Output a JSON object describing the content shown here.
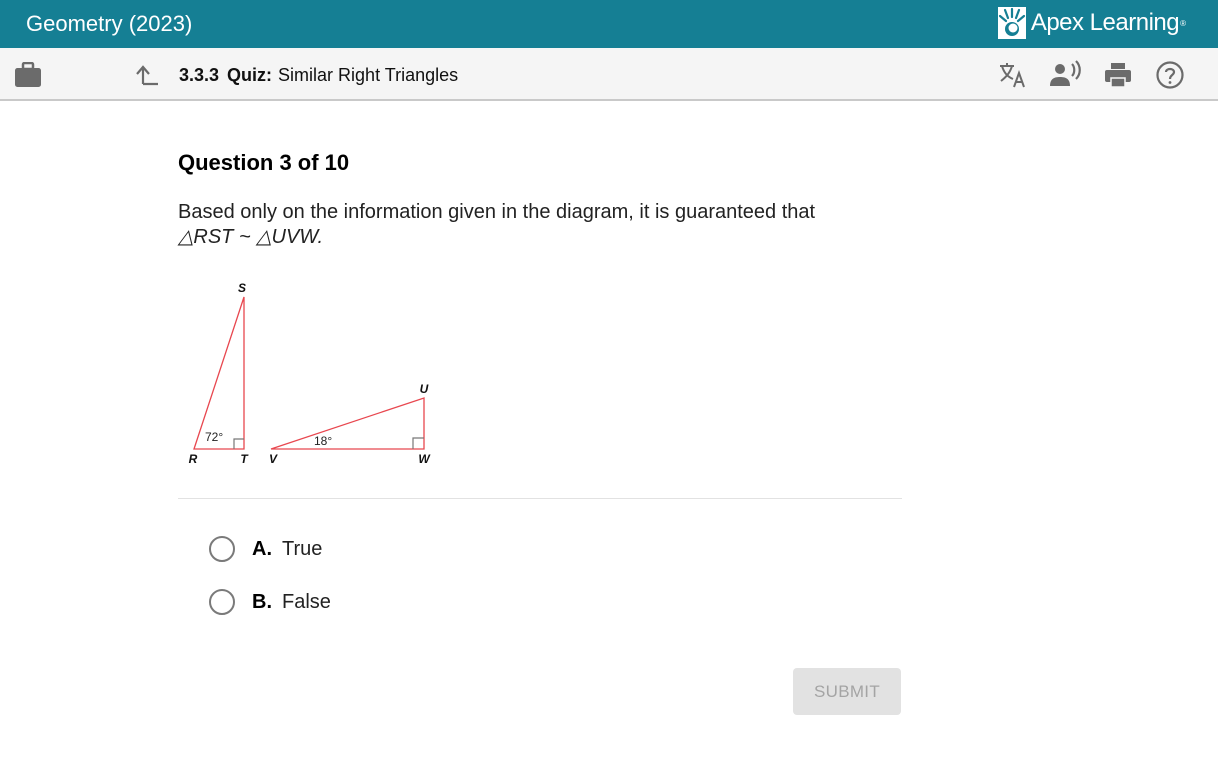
{
  "header": {
    "course_title": "Geometry (2023)",
    "brand": "Apex Learning",
    "brand_mark": "®",
    "accent_color": "#157f94"
  },
  "subheader": {
    "lesson_number": "3.3.3",
    "lesson_type": "Quiz:",
    "lesson_title": "Similar Right Triangles",
    "icons": [
      "briefcase-icon",
      "up-arrow-icon",
      "translate-icon",
      "read-aloud-icon",
      "print-icon",
      "help-icon"
    ]
  },
  "question": {
    "heading": "Question 3 of 10",
    "prompt": "Based only on the information given in the diagram, it is guaranteed that",
    "statement": "△RST ~ △UVW."
  },
  "diagram": {
    "triangle1": {
      "vertices": [
        "R",
        "S",
        "T"
      ],
      "right_angle_at": "T",
      "angle_label": "72°",
      "angle_at": "R"
    },
    "triangle2": {
      "vertices": [
        "U",
        "V",
        "W"
      ],
      "right_angle_at": "W",
      "angle_label": "18°",
      "angle_at": "V"
    },
    "line_color": "#e8474f"
  },
  "options": [
    {
      "letter": "A.",
      "text": "True",
      "selected": false
    },
    {
      "letter": "B.",
      "text": "False",
      "selected": false
    }
  ],
  "submit": {
    "label": "SUBMIT",
    "enabled": false
  }
}
